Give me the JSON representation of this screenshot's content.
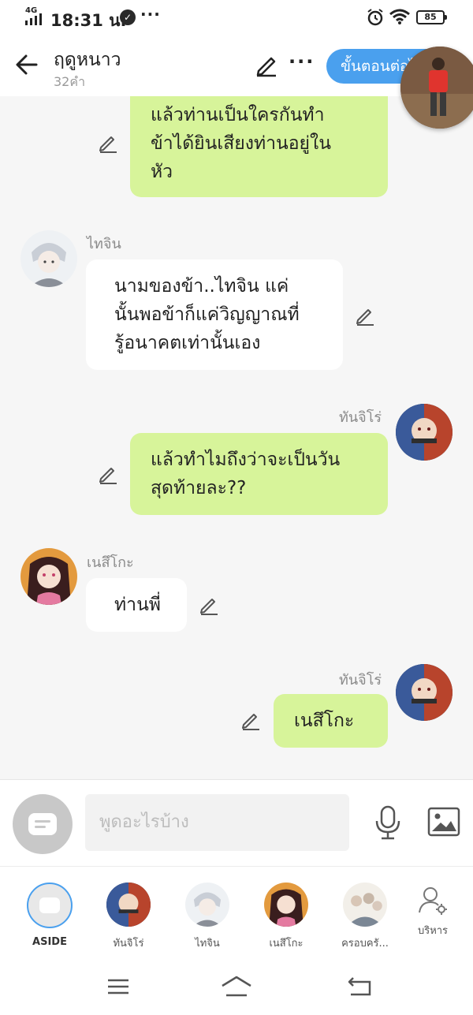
{
  "status_bar": {
    "network": "4G",
    "time": "18:31 น.",
    "more": "···",
    "battery": "85"
  },
  "header": {
    "title": "ฤดูหนาว",
    "subtitle": "32คำ",
    "more": "···",
    "steps_button": "ขั้นตอนต่อไป"
  },
  "messages": [
    {
      "side": "right",
      "sender": "",
      "text_lines": [
        "แล้วท่านเป็นใครกันทำ",
        "ข้าได้ยินเสียงท่านอยู่ใน",
        "หัว"
      ]
    },
    {
      "side": "left",
      "sender": "ไทจิน",
      "text_lines": [
        "นามของข้า..ไทจิน   แค่",
        "นั้นพอข้าก็แค่วิญญาณที่",
        "รู้อนาคตเท่านั้นเอง"
      ]
    },
    {
      "side": "right",
      "sender": "ทันจิโร่",
      "text_lines": [
        "แล้วทำไมถึงว่าจะเป็นวัน",
        "สุดท้ายละ??"
      ]
    },
    {
      "side": "left",
      "sender": "เนสึโกะ",
      "text_lines": [
        "ท่านพี่"
      ]
    },
    {
      "side": "right",
      "sender": "ทันจิโร่",
      "text_lines": [
        "เนสึโกะ"
      ]
    }
  ],
  "composer": {
    "placeholder": "พูดอะไรบ้าง"
  },
  "members": [
    {
      "label": "ASIDE"
    },
    {
      "label": "ทันจิโร่"
    },
    {
      "label": "ไทจิน"
    },
    {
      "label": "เนสึโกะ"
    },
    {
      "label": "ครอบครั..."
    },
    {
      "label": "บริหาร"
    }
  ],
  "colors": {
    "accent": "#4aa0ee",
    "right_bubble": "#d7f49a",
    "left_bubble": "#ffffff",
    "background": "#f6f6f6"
  },
  "icons": [
    "back-arrow-icon",
    "pencil-icon",
    "more-icon",
    "microphone-icon",
    "image-icon",
    "manage-user-icon",
    "menu-icon",
    "home-icon",
    "return-icon"
  ]
}
